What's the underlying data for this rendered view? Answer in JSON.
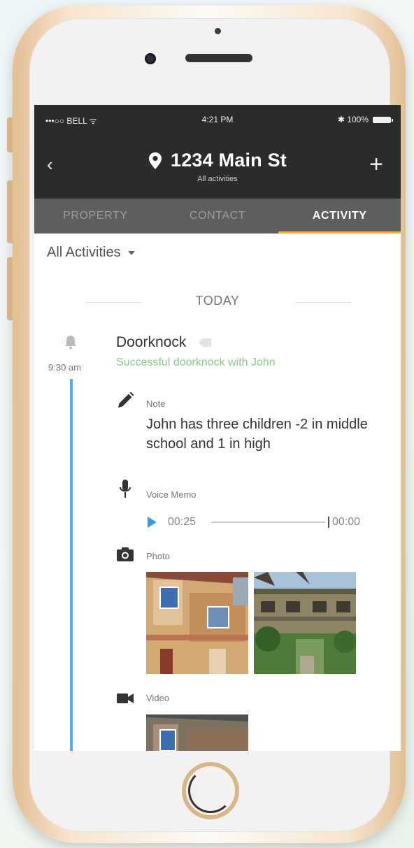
{
  "status_bar": {
    "carrier": "•••○○ BELL ᯤ",
    "time": "4:21 PM",
    "battery": "✱ 100%"
  },
  "nav": {
    "back": "‹",
    "title": "1234 Main St",
    "subtitle": "All activities",
    "add": "+"
  },
  "tabs": [
    {
      "label": "PROPERTY",
      "active": false
    },
    {
      "label": "CONTACT",
      "active": false
    },
    {
      "label": "ACTIVITY",
      "active": true
    }
  ],
  "filter": {
    "label": "All Activities"
  },
  "day_separator": "TODAY",
  "activity": {
    "time": "9:30 am",
    "icon": "bell-icon",
    "title": "Doorknock",
    "description": "Successful doorknock with John",
    "note": {
      "label": "Note",
      "text": "John has three children -2 in middle school and 1 in high"
    },
    "voice_memo": {
      "label": "Voice Memo",
      "elapsed": "00:25",
      "total": "00:00"
    },
    "photo": {
      "label": "Photo"
    },
    "video": {
      "label": "Video"
    }
  },
  "colors": {
    "nav_bg": "#2b2b2b",
    "tabs_bg": "#5e5e5e",
    "tab_accent": "#f0a93b",
    "timeline": "#5aa6e8",
    "success_text": "#8bc88b",
    "play": "#3a9be4",
    "phone_gold": "#e3bf94"
  }
}
